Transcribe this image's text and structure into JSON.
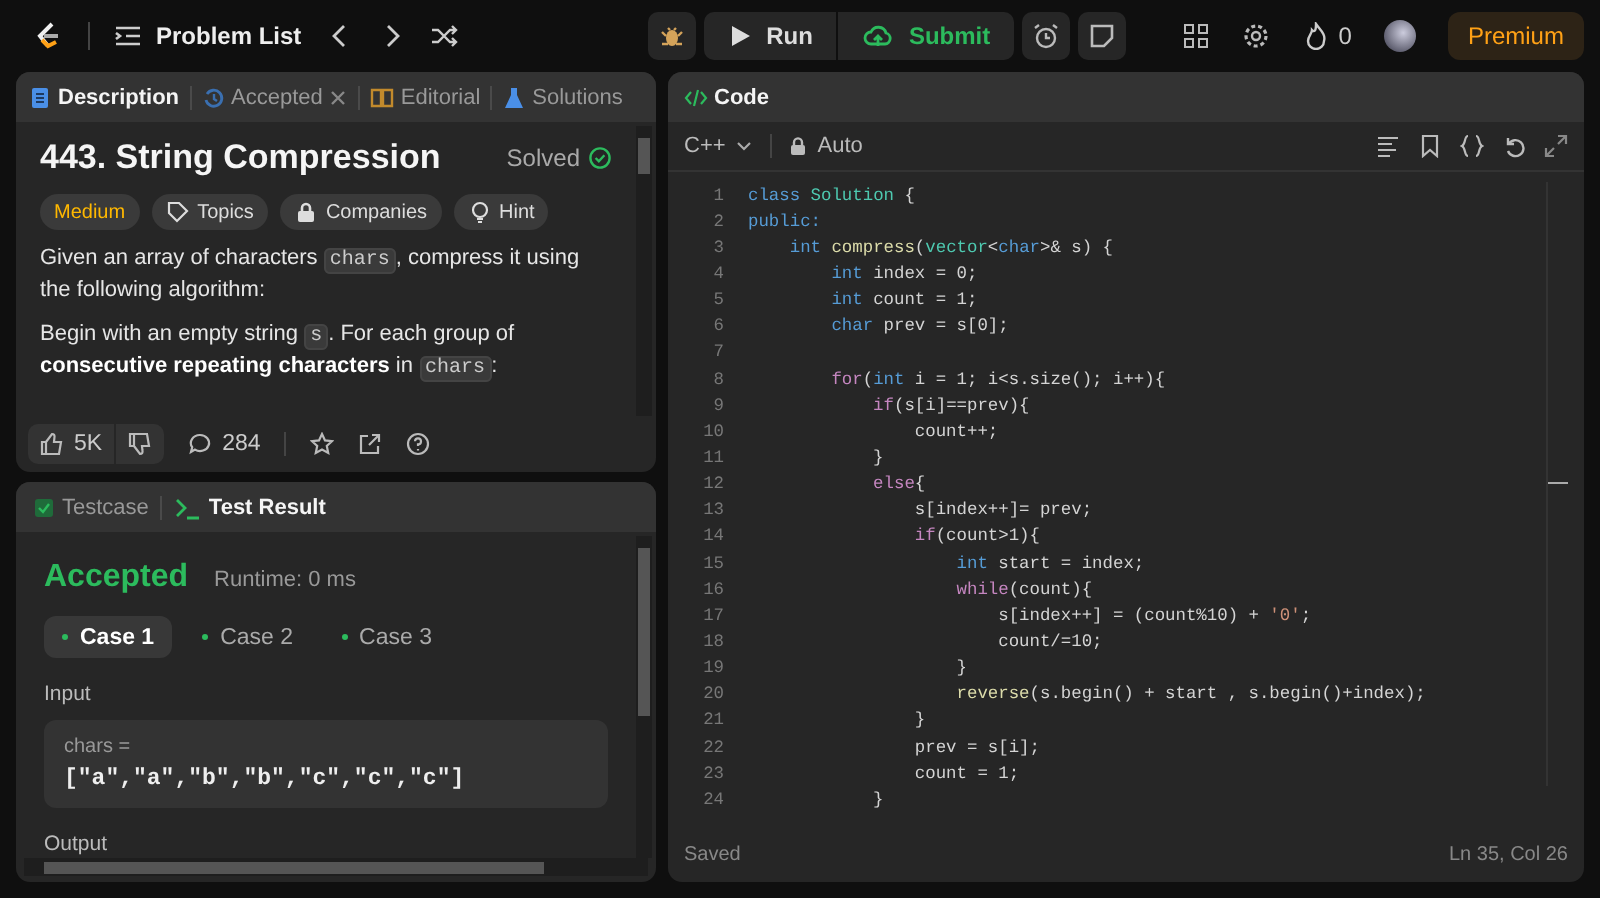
{
  "topbar": {
    "nav_title": "Problem List",
    "run": "Run",
    "submit": "Submit",
    "streak": "0",
    "premium": "Premium"
  },
  "description_panel": {
    "tabs": [
      {
        "label": "Description",
        "selected": true,
        "closable": false
      },
      {
        "label": "Accepted",
        "selected": false,
        "closable": true
      },
      {
        "label": "Editorial",
        "selected": false,
        "closable": false
      },
      {
        "label": "Solutions",
        "selected": false,
        "closable": false
      }
    ],
    "title": "443. String Compression",
    "status": "Solved",
    "tags": [
      {
        "label": "Medium",
        "kind": "difficulty"
      },
      {
        "label": "Topics",
        "kind": "topics"
      },
      {
        "label": "Companies",
        "kind": "companies"
      },
      {
        "label": "Hint",
        "kind": "hint"
      }
    ],
    "paragraphs": [
      [
        {
          "kind": "text",
          "text": "Given an array of characters "
        },
        {
          "kind": "code",
          "text": "chars"
        },
        {
          "kind": "text",
          "text": ", compress it using the following algorithm:"
        }
      ],
      [
        {
          "kind": "text",
          "text": "Begin with an empty string "
        },
        {
          "kind": "code",
          "text": "s"
        },
        {
          "kind": "text",
          "text": ". For each group of "
        },
        {
          "kind": "bold",
          "text": "consecutive repeating characters"
        },
        {
          "kind": "text",
          "text": " in "
        },
        {
          "kind": "code",
          "text": "chars"
        },
        {
          "kind": "text",
          "text": ":"
        }
      ]
    ],
    "likes": "5K",
    "comments": "284"
  },
  "result_panel": {
    "tabs": [
      {
        "label": "Testcase",
        "selected": false
      },
      {
        "label": "Test Result",
        "selected": true
      }
    ],
    "verdict": "Accepted",
    "runtime": "Runtime: 0 ms",
    "cases": [
      {
        "label": "Case 1",
        "selected": true
      },
      {
        "label": "Case 2",
        "selected": false
      },
      {
        "label": "Case 3",
        "selected": false
      }
    ],
    "input_label": "Input",
    "var_name": "chars =",
    "var_value": "[\"a\",\"a\",\"b\",\"b\",\"c\",\"c\",\"c\"]",
    "output_label": "Output"
  },
  "code_panel": {
    "title": "Code",
    "language": "C++",
    "mode": "Auto",
    "lines": [
      {
        "num": "1",
        "tokens": [
          {
            "kind": "kw",
            "text": "class"
          },
          {
            "kind": "ty",
            "text": " Solution"
          },
          {
            "kind": "p",
            "text": " {"
          }
        ]
      },
      {
        "num": "2",
        "tokens": [
          {
            "kind": "kw",
            "text": "public:"
          }
        ]
      },
      {
        "num": "3",
        "tokens": [
          {
            "kind": "kw",
            "text": "    int"
          },
          {
            "kind": "fn",
            "text": " compress"
          },
          {
            "kind": "p",
            "text": "("
          },
          {
            "kind": "ty",
            "text": "vector"
          },
          {
            "kind": "p",
            "text": "<"
          },
          {
            "kind": "kw",
            "text": "char"
          },
          {
            "kind": "p",
            "text": ">& s) {"
          }
        ]
      },
      {
        "num": "4",
        "tokens": [
          {
            "kind": "kw",
            "text": "        int"
          },
          {
            "kind": "p",
            "text": " index = 0;"
          }
        ]
      },
      {
        "num": "5",
        "tokens": [
          {
            "kind": "kw",
            "text": "        int"
          },
          {
            "kind": "p",
            "text": " count = 1;"
          }
        ]
      },
      {
        "num": "6",
        "tokens": [
          {
            "kind": "kw",
            "text": "        char"
          },
          {
            "kind": "p",
            "text": " prev = s[0];"
          }
        ]
      },
      {
        "num": "7"
      },
      {
        "num": "8",
        "tokens": [
          {
            "kind": "ctl",
            "text": "        for"
          },
          {
            "kind": "p",
            "text": "("
          },
          {
            "kind": "kw",
            "text": "int"
          },
          {
            "kind": "p",
            "text": " i = 1; i<s.size(); i++){"
          }
        ]
      },
      {
        "num": "9",
        "tokens": [
          {
            "kind": "ctl",
            "text": "            if"
          },
          {
            "kind": "p",
            "text": "(s[i]==prev){"
          }
        ]
      },
      {
        "num": "10",
        "tokens": [
          {
            "kind": "p",
            "text": "                count++;"
          }
        ]
      },
      {
        "num": "11",
        "tokens": [
          {
            "kind": "p",
            "text": "            }"
          }
        ]
      },
      {
        "num": "12",
        "tokens": [
          {
            "kind": "ctl",
            "text": "            else"
          },
          {
            "kind": "p",
            "text": "{"
          }
        ]
      },
      {
        "num": "13",
        "tokens": [
          {
            "kind": "p",
            "text": "                s[index++]= prev;"
          }
        ]
      },
      {
        "num": "14",
        "tokens": [
          {
            "kind": "ctl",
            "text": "                if"
          },
          {
            "kind": "p",
            "text": "(count>1){"
          }
        ]
      },
      {
        "num": "15",
        "tokens": [
          {
            "kind": "kw",
            "text": "                    int"
          },
          {
            "kind": "p",
            "text": " start = index;"
          }
        ]
      },
      {
        "num": "16",
        "tokens": [
          {
            "kind": "ctl",
            "text": "                    while"
          },
          {
            "kind": "p",
            "text": "(count){"
          }
        ]
      },
      {
        "num": "17",
        "tokens": [
          {
            "kind": "p",
            "text": "                        s[index++] = (count%10) + "
          },
          {
            "kind": "str",
            "text": "'0'"
          },
          {
            "kind": "p",
            "text": ";"
          }
        ]
      },
      {
        "num": "18",
        "tokens": [
          {
            "kind": "p",
            "text": "                        count/=10;"
          }
        ]
      },
      {
        "num": "19",
        "tokens": [
          {
            "kind": "p",
            "text": "                    }"
          }
        ]
      },
      {
        "num": "20",
        "tokens": [
          {
            "kind": "fn",
            "text": "                    reverse"
          },
          {
            "kind": "p",
            "text": "(s.begin() + start , s.begin()+index);"
          }
        ]
      },
      {
        "num": "21",
        "tokens": [
          {
            "kind": "p",
            "text": "                }"
          }
        ]
      },
      {
        "num": "22",
        "tokens": [
          {
            "kind": "p",
            "text": "                prev = s[i];"
          }
        ]
      },
      {
        "num": "23",
        "tokens": [
          {
            "kind": "p",
            "text": "                count = 1;"
          }
        ]
      },
      {
        "num": "24",
        "tokens": [
          {
            "kind": "p",
            "text": "            }"
          }
        ]
      }
    ],
    "save_state": "Saved",
    "cursor": "Ln 35, Col 26"
  }
}
